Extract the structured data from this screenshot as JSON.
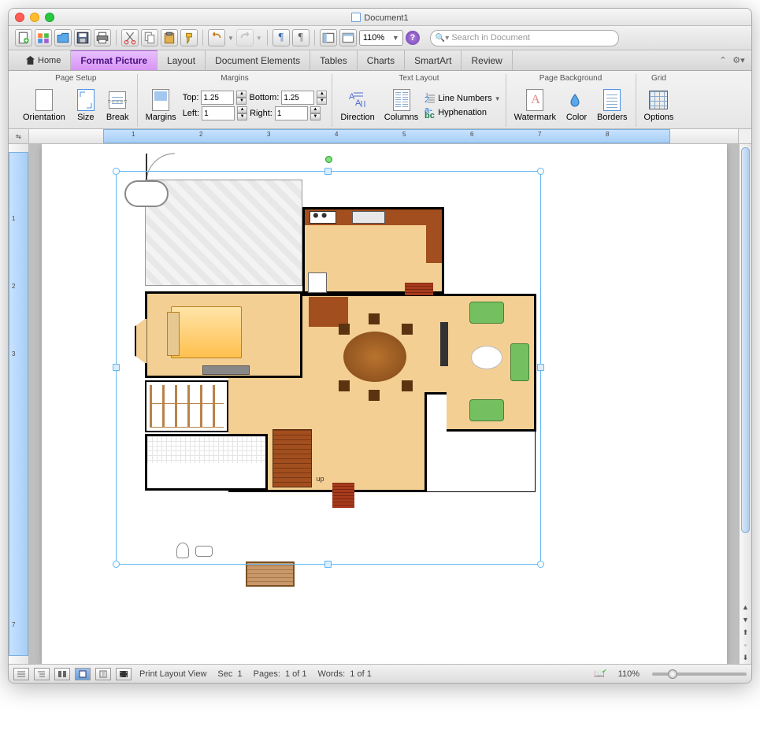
{
  "window": {
    "title": "Document1"
  },
  "search": {
    "placeholder": "Search in Document"
  },
  "toolbar": {
    "zoom": "110%"
  },
  "tabs": {
    "home": "Home",
    "format_picture": "Format Picture",
    "layout": "Layout",
    "document_elements": "Document Elements",
    "tables": "Tables",
    "charts": "Charts",
    "smartart": "SmartArt",
    "review": "Review"
  },
  "ribbon": {
    "groups": {
      "page_setup": "Page Setup",
      "margins": "Margins",
      "text_layout": "Text Layout",
      "page_background": "Page Background",
      "grid": "Grid"
    },
    "page_setup": {
      "orientation": "Orientation",
      "size": "Size",
      "break": "Break"
    },
    "margins": {
      "button": "Margins",
      "top_label": "Top:",
      "top_val": "1.25",
      "bottom_label": "Bottom:",
      "bottom_val": "1.25",
      "left_label": "Left:",
      "left_val": "1",
      "right_label": "Right:",
      "right_val": "1"
    },
    "text_layout": {
      "direction": "Direction",
      "columns": "Columns",
      "line_numbers": "Line Numbers",
      "hyphenation": "Hyphenation"
    },
    "page_background": {
      "watermark": "Watermark",
      "color": "Color",
      "borders": "Borders"
    },
    "grid": {
      "options": "Options"
    }
  },
  "ruler": {
    "h": [
      "1",
      "2",
      "3",
      "4",
      "5",
      "6",
      "7",
      "8"
    ],
    "v": [
      "1",
      "2",
      "3",
      "7"
    ]
  },
  "floorplan": {
    "stairs_label": "up"
  },
  "status": {
    "view_label": "Print Layout View",
    "sec_label": "Sec",
    "sec_val": "1",
    "pages_label": "Pages:",
    "pages_val": "1 of 1",
    "words_label": "Words:",
    "words_val": "1 of 1",
    "zoom": "110%"
  }
}
